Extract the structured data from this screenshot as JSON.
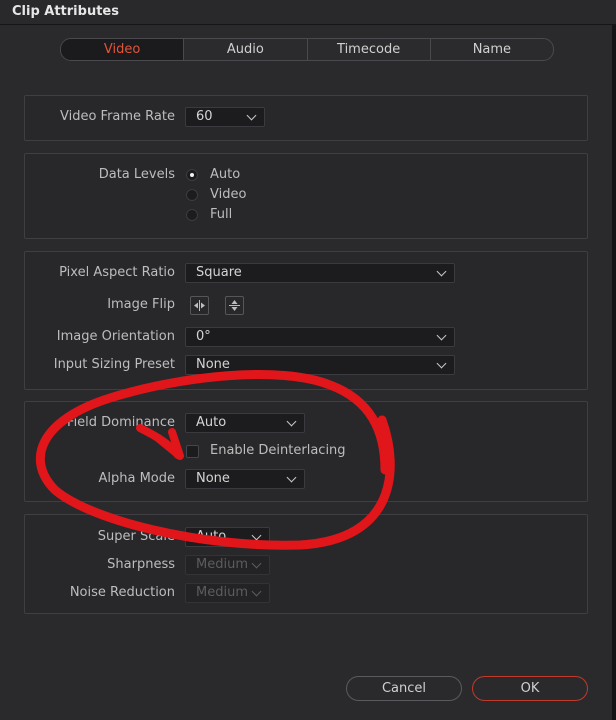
{
  "window": {
    "title": "Clip Attributes"
  },
  "tabs": [
    {
      "label": "Video",
      "active": true
    },
    {
      "label": "Audio",
      "active": false
    },
    {
      "label": "Timecode",
      "active": false
    },
    {
      "label": "Name",
      "active": false
    }
  ],
  "video_frame_rate": {
    "label": "Video Frame Rate",
    "value": "60"
  },
  "data_levels": {
    "label": "Data Levels",
    "options": [
      {
        "label": "Auto",
        "selected": true
      },
      {
        "label": "Video",
        "selected": false
      },
      {
        "label": "Full",
        "selected": false
      }
    ]
  },
  "pixel_aspect_ratio": {
    "label": "Pixel Aspect Ratio",
    "value": "Square"
  },
  "image_flip": {
    "label": "Image Flip",
    "icons": [
      "flip-horizontal-icon",
      "flip-vertical-icon"
    ]
  },
  "image_orientation": {
    "label": "Image Orientation",
    "value": "0°"
  },
  "input_sizing_preset": {
    "label": "Input Sizing Preset",
    "value": "None"
  },
  "field_dominance": {
    "label": "Field Dominance",
    "value": "Auto"
  },
  "enable_deinterlacing": {
    "label": "Enable Deinterlacing",
    "checked": false
  },
  "alpha_mode": {
    "label": "Alpha Mode",
    "value": "None"
  },
  "super_scale": {
    "label": "Super Scale",
    "value": "Auto"
  },
  "sharpness": {
    "label": "Sharpness",
    "value": "Medium",
    "disabled": true
  },
  "noise_reduction": {
    "label": "Noise Reduction",
    "value": "Medium",
    "disabled": true
  },
  "buttons": {
    "cancel": "Cancel",
    "ok": "OK"
  },
  "colors": {
    "accent": "#e2553a",
    "annotation": "#e0161b",
    "ok_border": "#c0392b"
  },
  "annotation": {
    "type": "hand-drawn red circle with arrow",
    "target": "Enable Deinterlacing"
  }
}
